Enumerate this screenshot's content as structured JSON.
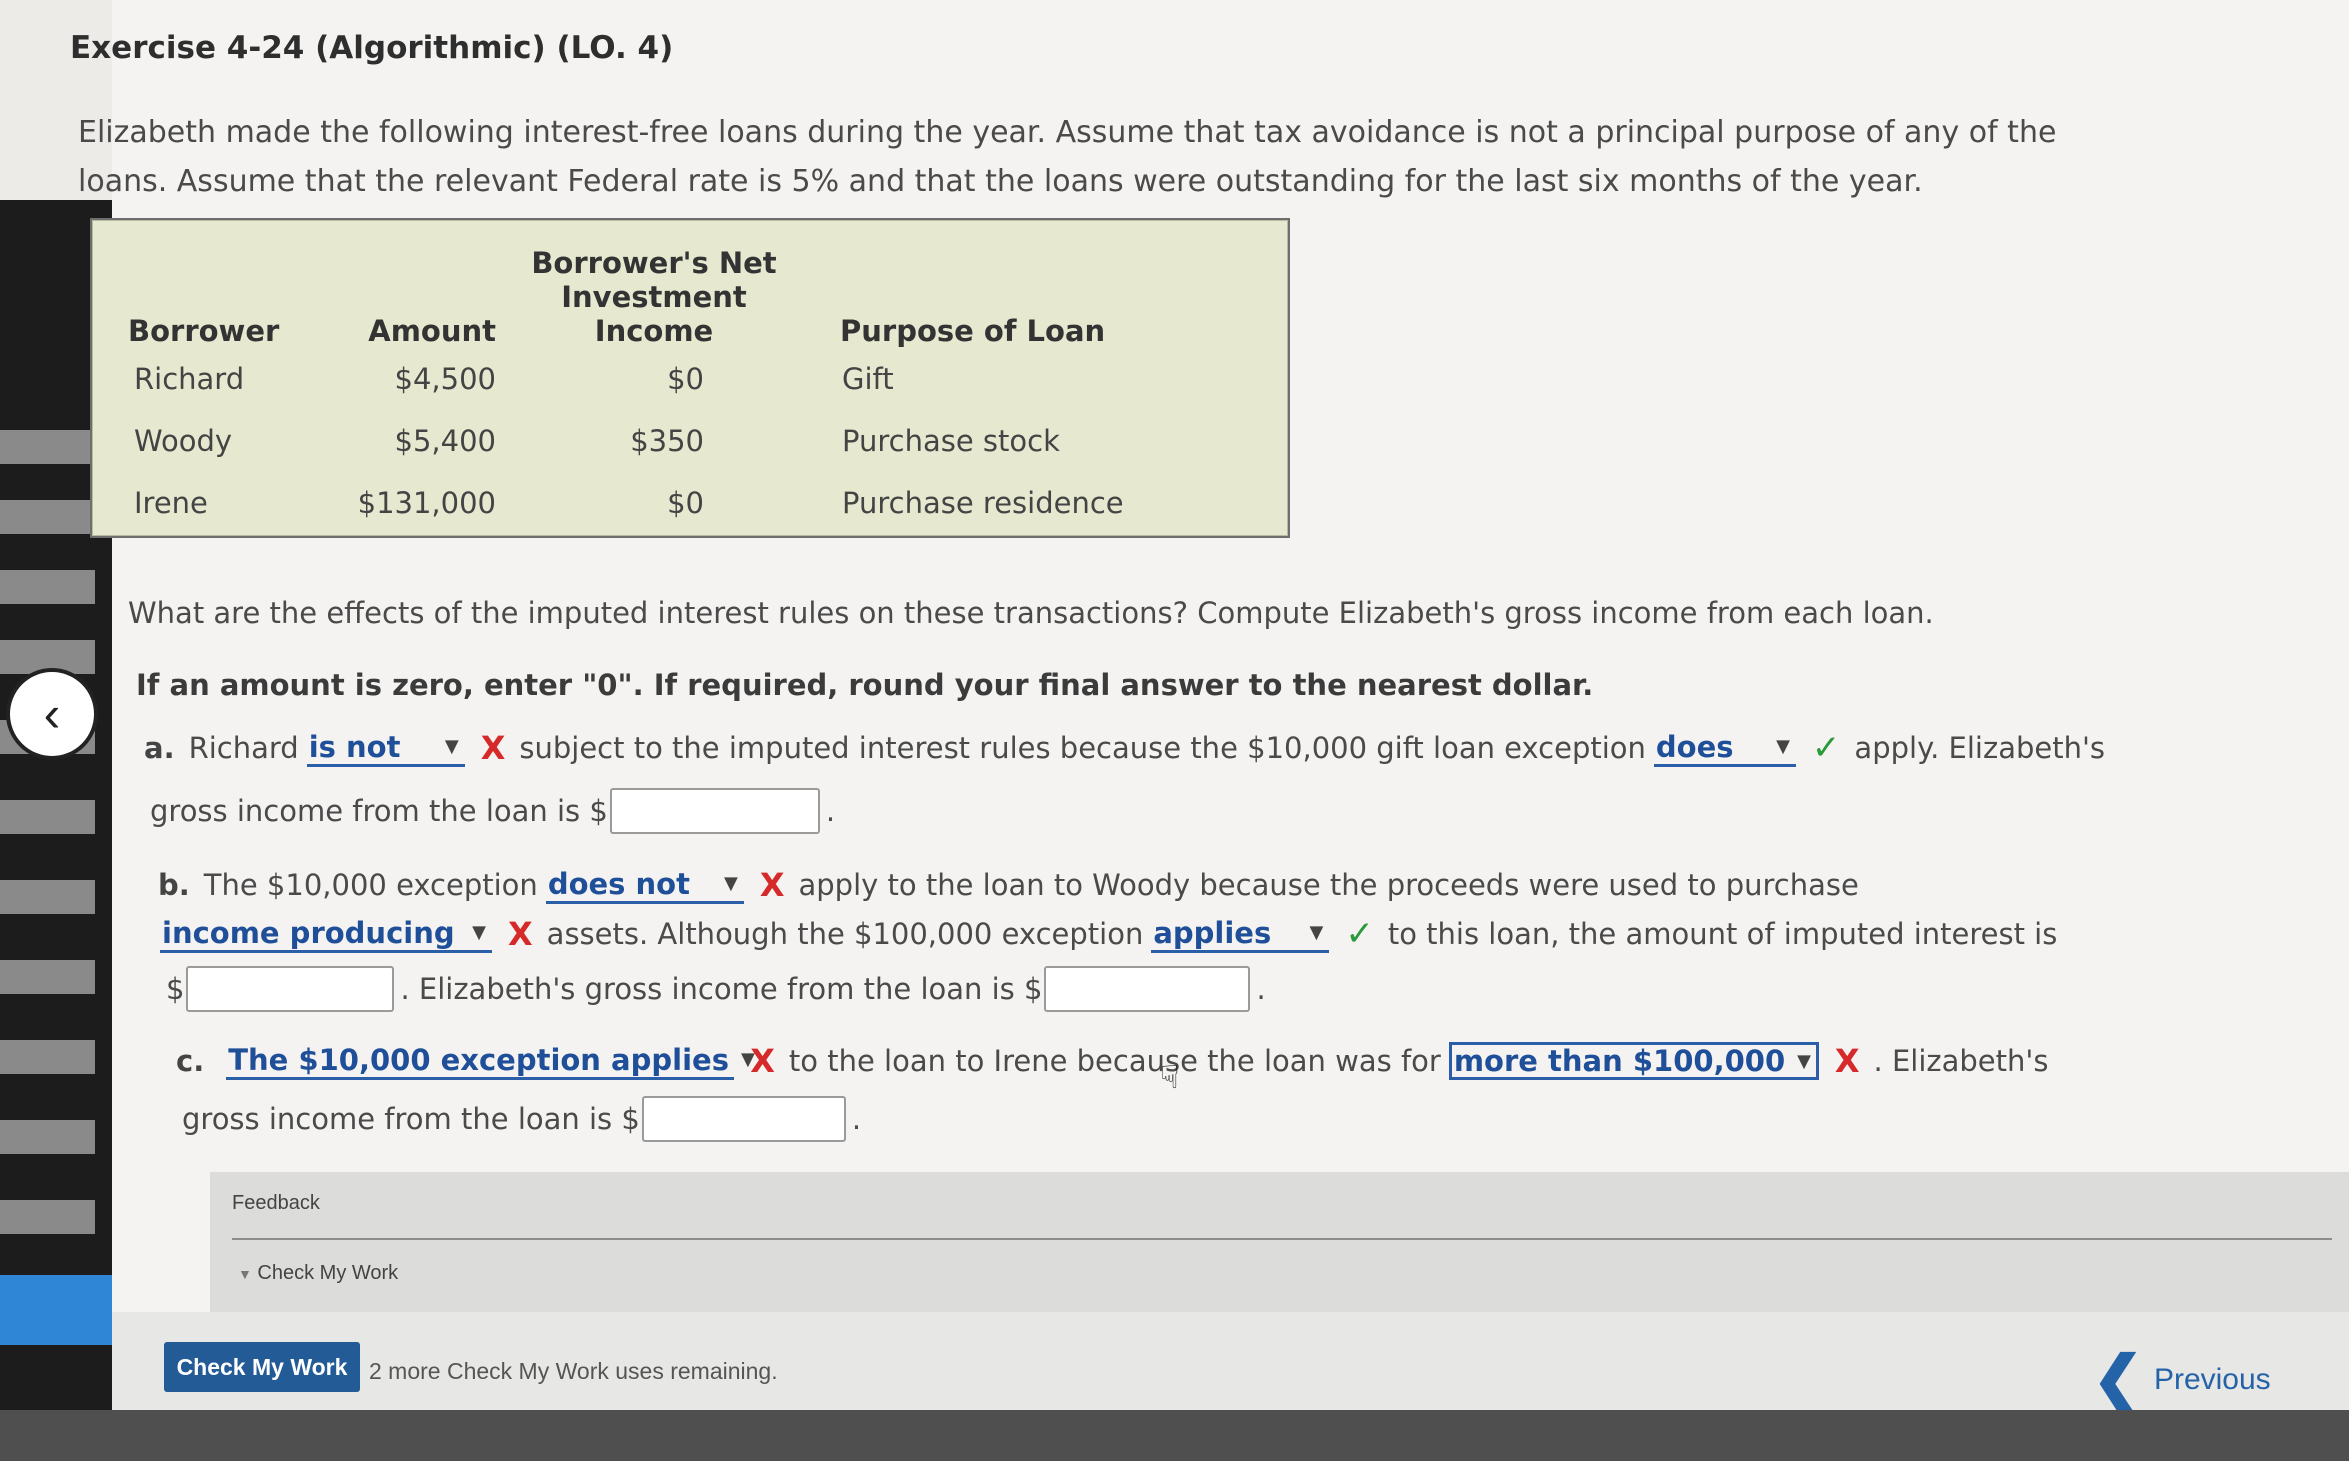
{
  "title": "Exercise 4-24 (Algorithmic) (LO. 4)",
  "intro": "Elizabeth made the following interest-free loans during the year. Assume that tax avoidance is not a principal purpose of any of the loans. Assume that the relevant Federal rate is 5% and that the loans were outstanding for the last six months of the year.",
  "table": {
    "headers": {
      "borrower": "Borrower",
      "amount": "Amount",
      "income_line1": "Borrower's Net",
      "income_line2": "Investment Income",
      "purpose": "Purpose of Loan"
    },
    "rows": [
      {
        "borrower": "Richard",
        "amount": "$4,500",
        "income": "$0",
        "purpose": "Gift"
      },
      {
        "borrower": "Woody",
        "amount": "$5,400",
        "income": "$350",
        "purpose": "Purchase stock"
      },
      {
        "borrower": "Irene",
        "amount": "$131,000",
        "income": "$0",
        "purpose": "Purchase residence"
      }
    ]
  },
  "question": "What are the effects of the imputed interest rules on these transactions? Compute Elizabeth's gross income from each loan.",
  "instruction": "If an amount is zero, enter \"0\". If required, round your final answer to the nearest dollar.",
  "part_a": {
    "label": "a.",
    "t1": "Richard",
    "dd1": "is not",
    "t2": "subject to the imputed interest rules because the $10,000 gift loan exception",
    "dd2": "does",
    "t3": "apply. Elizabeth's",
    "t4": "gross income from the loan is $",
    "input_value": "",
    "t5": "."
  },
  "part_b": {
    "label": "b.",
    "t1": "The $10,000 exception",
    "dd1": "does not",
    "t2": "apply to the loan to Woody because the proceeds were used to purchase",
    "dd2": "income producing",
    "t3": "assets. Although the $100,000 exception",
    "dd3": "applies",
    "t4": "to this loan, the amount of imputed interest is",
    "t5": "$",
    "input1_value": "",
    "t6": ". Elizabeth's gross income from the loan is $",
    "input2_value": "",
    "t7": "."
  },
  "part_c": {
    "label": "c.",
    "dd1": "The $10,000 exception applies",
    "t1": "to the loan to Irene because the loan was for",
    "dd2": "more than $100,000",
    "t2": ". Elizabeth's",
    "t3": "gross income from the loan is $",
    "input_value": "",
    "t4": "."
  },
  "marks": {
    "wrong": "X",
    "correct": "✓"
  },
  "feedback": {
    "label": "Feedback",
    "toggle": "Check My Work"
  },
  "footer": {
    "button": "Check My Work",
    "remaining": "2 more Check My Work uses remaining.",
    "previous": "Previous"
  },
  "colors": {
    "accent": "#2a5ea8",
    "wrong": "#d62a2a",
    "correct": "#2b9a3a",
    "button_bg": "#235b97",
    "table_bg": "#e6e9d0"
  }
}
